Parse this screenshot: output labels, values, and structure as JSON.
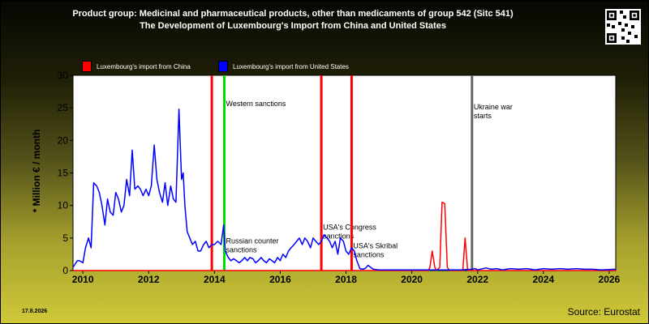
{
  "header": {
    "title_line1": "Product group: Medicinal and pharmaceutical products, other than medicaments of group 542 (Sitc 541)",
    "title_line2": "The Development of Luxembourg's Import from  China and United States"
  },
  "footer": {
    "date": "17.8.2026",
    "source": "Source: Eurostat"
  },
  "chart_data": {
    "type": "line",
    "title": "The Development of Luxembourg's Import from  China and United States",
    "ylabel": "* Million € / month",
    "xlabel": "",
    "xlim": [
      2009.7,
      2026.2
    ],
    "ylim": [
      0,
      30
    ],
    "x_ticks": [
      "2010",
      "2012",
      "2014",
      "2016",
      "2018",
      "2020",
      "2022",
      "2024",
      "2026"
    ],
    "y_ticks": [
      "0",
      "5",
      "10",
      "15",
      "20",
      "25",
      "30"
    ],
    "grid": false,
    "legend_position": "top-left",
    "series": [
      {
        "name": "Luxembourg's import from China",
        "color": "#ff0000",
        "points": [
          [
            2009.7,
            0
          ],
          [
            2020.5,
            0
          ],
          [
            2020.55,
            0.5
          ],
          [
            2020.62,
            3
          ],
          [
            2020.7,
            0.5
          ],
          [
            2020.75,
            0
          ],
          [
            2020.85,
            0.5
          ],
          [
            2020.92,
            10.5
          ],
          [
            2021.0,
            10.3
          ],
          [
            2021.08,
            0.5
          ],
          [
            2021.15,
            0
          ],
          [
            2021.55,
            0
          ],
          [
            2021.62,
            5
          ],
          [
            2021.7,
            0
          ],
          [
            2026.2,
            0
          ]
        ]
      },
      {
        "name": "Luxembourg's import from United States",
        "color": "#0000ff",
        "points": [
          [
            2009.7,
            0.5
          ],
          [
            2009.83,
            1.5
          ],
          [
            2009.9,
            1.5
          ],
          [
            2010.0,
            1.2
          ],
          [
            2010.08,
            3.5
          ],
          [
            2010.17,
            5
          ],
          [
            2010.25,
            3.5
          ],
          [
            2010.33,
            13.5
          ],
          [
            2010.42,
            13
          ],
          [
            2010.5,
            12
          ],
          [
            2010.58,
            10
          ],
          [
            2010.67,
            7
          ],
          [
            2010.75,
            11
          ],
          [
            2010.83,
            9
          ],
          [
            2010.92,
            8.5
          ],
          [
            2011.0,
            12
          ],
          [
            2011.08,
            11
          ],
          [
            2011.17,
            9
          ],
          [
            2011.25,
            10
          ],
          [
            2011.33,
            14
          ],
          [
            2011.42,
            11.5
          ],
          [
            2011.5,
            18.5
          ],
          [
            2011.58,
            12.5
          ],
          [
            2011.67,
            13
          ],
          [
            2011.75,
            12.5
          ],
          [
            2011.83,
            11.5
          ],
          [
            2011.92,
            12.5
          ],
          [
            2012.0,
            11.5
          ],
          [
            2012.08,
            13
          ],
          [
            2012.17,
            19.3
          ],
          [
            2012.25,
            14
          ],
          [
            2012.33,
            12
          ],
          [
            2012.42,
            10.5
          ],
          [
            2012.5,
            13.5
          ],
          [
            2012.58,
            10
          ],
          [
            2012.67,
            13
          ],
          [
            2012.75,
            11
          ],
          [
            2012.83,
            10.5
          ],
          [
            2012.92,
            24.8
          ],
          [
            2013.0,
            14
          ],
          [
            2013.05,
            15
          ],
          [
            2013.1,
            10
          ],
          [
            2013.17,
            6
          ],
          [
            2013.25,
            5
          ],
          [
            2013.33,
            4
          ],
          [
            2013.42,
            4.5
          ],
          [
            2013.5,
            3
          ],
          [
            2013.58,
            3
          ],
          [
            2013.67,
            4
          ],
          [
            2013.75,
            4.5
          ],
          [
            2013.83,
            3.5
          ],
          [
            2013.92,
            4
          ],
          [
            2014.0,
            4
          ],
          [
            2014.1,
            4.5
          ],
          [
            2014.2,
            4
          ],
          [
            2014.28,
            7
          ],
          [
            2014.33,
            3
          ],
          [
            2014.42,
            2
          ],
          [
            2014.5,
            1.5
          ],
          [
            2014.58,
            1.8
          ],
          [
            2014.67,
            1.5
          ],
          [
            2014.75,
            1.2
          ],
          [
            2014.83,
            1.5
          ],
          [
            2014.92,
            2
          ],
          [
            2015.0,
            1.5
          ],
          [
            2015.08,
            2
          ],
          [
            2015.17,
            1.8
          ],
          [
            2015.25,
            1.2
          ],
          [
            2015.33,
            1.5
          ],
          [
            2015.42,
            2
          ],
          [
            2015.5,
            1.5
          ],
          [
            2015.58,
            1.2
          ],
          [
            2015.67,
            1.8
          ],
          [
            2015.75,
            1.5
          ],
          [
            2015.83,
            1.2
          ],
          [
            2015.92,
            2
          ],
          [
            2016.0,
            1.5
          ],
          [
            2016.08,
            2.5
          ],
          [
            2016.17,
            2
          ],
          [
            2016.25,
            3
          ],
          [
            2016.33,
            3.5
          ],
          [
            2016.42,
            4
          ],
          [
            2016.5,
            4.5
          ],
          [
            2016.58,
            5
          ],
          [
            2016.67,
            4
          ],
          [
            2016.75,
            5
          ],
          [
            2016.83,
            4.5
          ],
          [
            2016.92,
            3.5
          ],
          [
            2017.0,
            5
          ],
          [
            2017.08,
            4.5
          ],
          [
            2017.17,
            4
          ],
          [
            2017.25,
            4.5
          ],
          [
            2017.33,
            5.5
          ],
          [
            2017.42,
            5
          ],
          [
            2017.5,
            4.5
          ],
          [
            2017.58,
            3.5
          ],
          [
            2017.67,
            4.5
          ],
          [
            2017.75,
            2.5
          ],
          [
            2017.83,
            5
          ],
          [
            2017.92,
            4.5
          ],
          [
            2018.0,
            3
          ],
          [
            2018.08,
            2.5
          ],
          [
            2018.17,
            3.5
          ],
          [
            2018.25,
            3
          ],
          [
            2018.33,
            1.5
          ],
          [
            2018.42,
            0.3
          ],
          [
            2018.5,
            0.2
          ],
          [
            2018.58,
            0.3
          ],
          [
            2018.67,
            0.8
          ],
          [
            2018.75,
            0.5
          ],
          [
            2018.83,
            0.2
          ],
          [
            2019.0,
            0.1
          ],
          [
            2020.0,
            0.1
          ],
          [
            2021.5,
            0.1
          ],
          [
            2021.83,
            0.2
          ],
          [
            2021.92,
            0.3
          ],
          [
            2022.0,
            0.1
          ],
          [
            2022.25,
            0.4
          ],
          [
            2022.42,
            0.2
          ],
          [
            2022.58,
            0.3
          ],
          [
            2022.75,
            0.1
          ],
          [
            2023.0,
            0.3
          ],
          [
            2023.25,
            0.2
          ],
          [
            2023.5,
            0.3
          ],
          [
            2023.75,
            0.1
          ],
          [
            2024.0,
            0.3
          ],
          [
            2024.25,
            0.2
          ],
          [
            2024.5,
            0.3
          ],
          [
            2024.75,
            0.2
          ],
          [
            2025.0,
            0.3
          ],
          [
            2025.25,
            0.2
          ],
          [
            2025.5,
            0.2
          ],
          [
            2025.75,
            0.1
          ],
          [
            2026.2,
            0.2
          ]
        ]
      }
    ],
    "events": [
      {
        "x": 2013.92,
        "color": "#ff0000",
        "label": "",
        "label_y": 0
      },
      {
        "x": 2014.3,
        "color": "#00dd00",
        "label": "Western sanctions",
        "label_y": 25.3
      },
      {
        "x": 2014.3,
        "color": "#00dd00",
        "label": "Russian counter sanctions",
        "label_y": 4.2
      },
      {
        "x": 2017.25,
        "color": "#ff0000",
        "label": "USA's Congress sanctions",
        "label_y": 6.3
      },
      {
        "x": 2018.17,
        "color": "#ff0000",
        "label": "USA's Skribal sanctions",
        "label_y": 3.4
      },
      {
        "x": 2021.83,
        "color": "#666666",
        "label": "Ukraine war starts",
        "label_y": 24.8
      }
    ]
  }
}
